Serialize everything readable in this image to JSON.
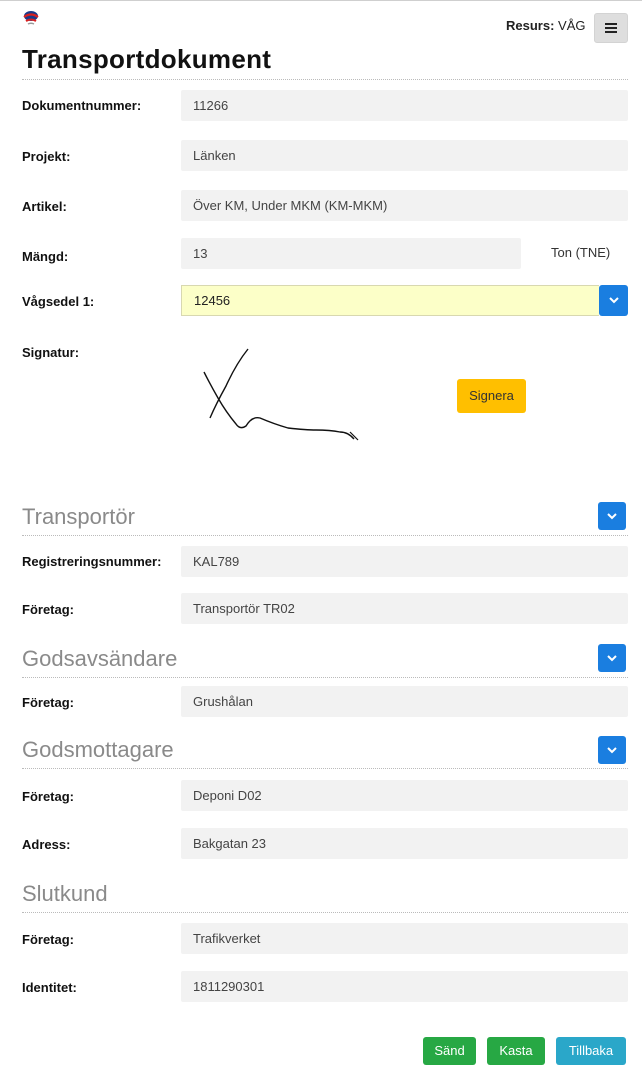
{
  "header": {
    "resurs_label": "Resurs:",
    "resurs_value": "VÅG"
  },
  "page_title": "Transportdokument",
  "document": {
    "dokumentnummer_label": "Dokumentnummer:",
    "dokumentnummer_value": "11266",
    "projekt_label": "Projekt:",
    "projekt_value": "Länken",
    "artikel_label": "Artikel:",
    "artikel_value": "Över KM, Under MKM (KM-MKM)",
    "mangd_label": "Mängd:",
    "mangd_value": "13",
    "mangd_unit": "Ton (TNE)",
    "vagsedel_label": "Vågsedel 1:",
    "vagsedel_value": "12456",
    "signatur_label": "Signatur:",
    "signera_button": "Signera"
  },
  "transportor": {
    "title": "Transportör",
    "reg_label": "Registreringsnummer:",
    "reg_value": "KAL789",
    "foretag_label": "Företag:",
    "foretag_value": "Transportör TR02"
  },
  "godsavsandare": {
    "title": "Godsavsändare",
    "foretag_label": "Företag:",
    "foretag_value": "Grushålan"
  },
  "godsmottagare": {
    "title": "Godsmottagare",
    "foretag_label": "Företag:",
    "foretag_value": "Deponi D02",
    "adress_label": "Adress:",
    "adress_value": "Bakgatan 23"
  },
  "slutkund": {
    "title": "Slutkund",
    "foretag_label": "Företag:",
    "foretag_value": "Trafikverket",
    "identitet_label": "Identitet:",
    "identitet_value": "1811290301"
  },
  "actions": {
    "sand": "Sänd",
    "kasta": "Kasta",
    "tillbaka": "Tillbaka"
  },
  "colors": {
    "primary": "#1a7ee0",
    "warning": "#ffbf00",
    "success": "#27a844",
    "info": "#2aa7c9",
    "highlight": "#fcffc8"
  }
}
